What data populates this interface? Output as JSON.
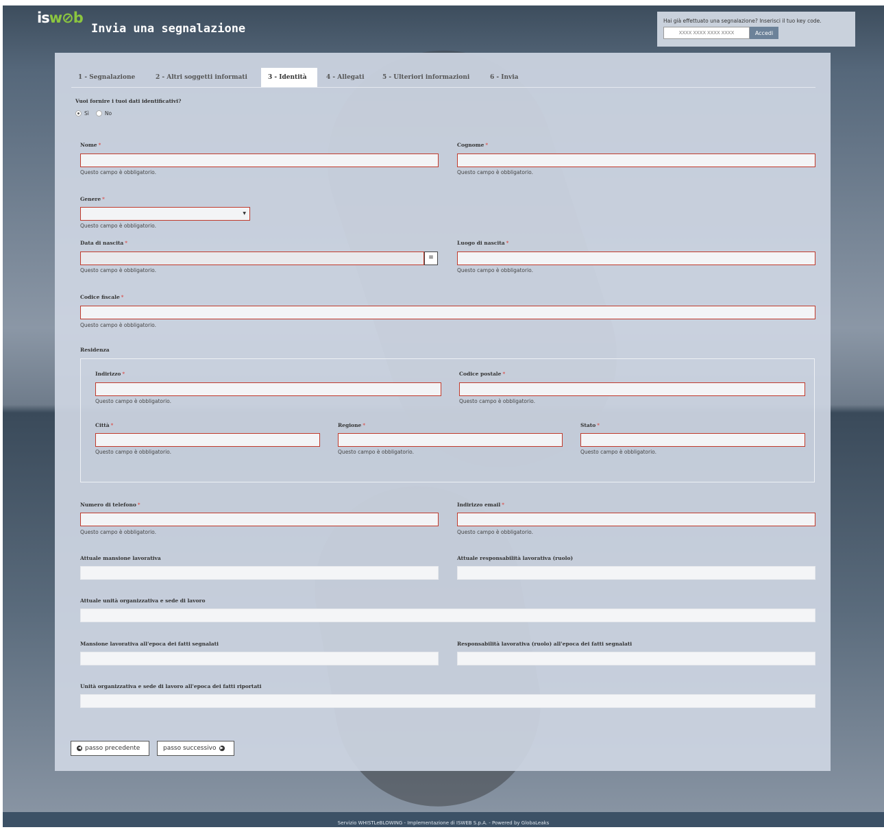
{
  "header": {
    "logo_is": "is",
    "logo_web": "w⊘b",
    "title": "Invia una segnalazione"
  },
  "keycode": {
    "prompt": "Hai già effettuato una segnalazione? Inserisci il tuo key code.",
    "placeholder": "XXXX XXXX XXXX XXXX",
    "button": "Accedi"
  },
  "tabs": [
    {
      "label": "1 - Segnalazione"
    },
    {
      "label": "2 - Altri soggetti informati"
    },
    {
      "label": "3 - Identità"
    },
    {
      "label": "4 - Allegati"
    },
    {
      "label": "5 - Ulteriori informazioni"
    },
    {
      "label": "6 - Invia"
    }
  ],
  "identity_question": "Vuoi fornire i tuoi dati identificativi?",
  "radio": {
    "yes": "Sì",
    "no": "No"
  },
  "required_mark": "*",
  "error_text": "Questo campo è obbligatorio.",
  "fields": {
    "nome": "Nome",
    "cognome": "Cognome",
    "genere": "Genere",
    "data_nascita": "Data di nascita",
    "luogo_nascita": "Luogo di nascita",
    "codice_fiscale": "Codice fiscale",
    "residenza": "Residenza",
    "indirizzo": "Indirizzo",
    "codice_postale": "Codice postale",
    "citta": "Città",
    "regione": "Regione",
    "stato": "Stato",
    "telefono": "Numero di telefono",
    "email": "Indirizzo email",
    "mansione": "Attuale mansione lavorativa",
    "responsabilita": "Attuale responsabilità lavorativa (ruolo)",
    "unita": "Attuale unità organizzativa e sede di lavoro",
    "mansione_epoca": "Mansione lavorativa all'epoca dei fatti segnalati",
    "responsabilita_epoca": "Responsabilità lavorativa (ruolo) all'epoca dei fatti segnalati",
    "unita_epoca": "Unità organizzativa e sede di lavoro all'epoca dei fatti riportati"
  },
  "nav": {
    "prev": "passo precedente",
    "next": "passo successivo"
  },
  "footer": "Servizio WHISTLeBLOWING - Implementazione di ISWEB S.p.A. - Powered by GlobaLeaks"
}
